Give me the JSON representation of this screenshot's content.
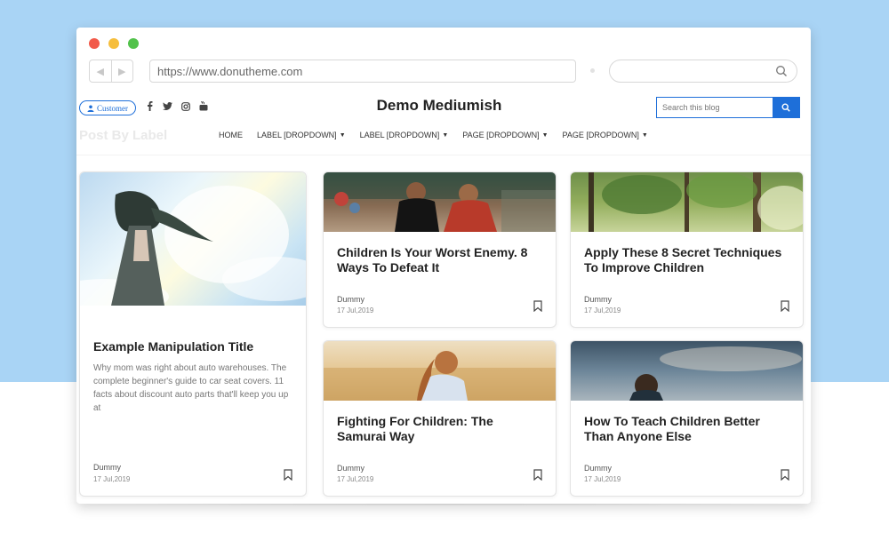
{
  "browser": {
    "url": "https://www.donutheme.com",
    "traffic_lights": [
      "#f25a4a",
      "#f6be3c",
      "#52c24b"
    ]
  },
  "header": {
    "customer_label": "Customer",
    "site_title": "Demo Mediumish",
    "search_placeholder": "Search this blog",
    "socials": [
      "facebook-icon",
      "twitter-icon",
      "instagram-icon",
      "youtube-icon"
    ]
  },
  "nav": {
    "faded_label": "Post By Label",
    "items": [
      {
        "label": "HOME",
        "dropdown": false
      },
      {
        "label": "LABEL [DROPDOWN]",
        "dropdown": true
      },
      {
        "label": "LABEL [DROPDOWN]",
        "dropdown": true
      },
      {
        "label": "PAGE [DROPDOWN]",
        "dropdown": true
      },
      {
        "label": "PAGE [DROPDOWN]",
        "dropdown": true
      }
    ]
  },
  "posts": [
    {
      "title": "Example Manipulation Title",
      "excerpt": "Why mom was right about auto warehouses. The complete beginner's guide to car seat covers. 11 facts about discount auto parts that'll keep you up at",
      "author": "Dummy",
      "date": "17 Jul,2019"
    },
    {
      "title": "Children Is Your Worst Enemy. 8 Ways To Defeat It",
      "author": "Dummy",
      "date": "17 Jul,2019"
    },
    {
      "title": "Apply These 8 Secret Techniques To Improve Children",
      "author": "Dummy",
      "date": "17 Jul,2019"
    },
    {
      "title": "Fighting For Children: The Samurai Way",
      "author": "Dummy",
      "date": "17 Jul,2019"
    },
    {
      "title": "How To Teach Children Better Than Anyone Else",
      "author": "Dummy",
      "date": "17 Jul,2019"
    }
  ],
  "colors": {
    "accent": "#1e6fd9",
    "backdrop": "#a9d4f5"
  }
}
